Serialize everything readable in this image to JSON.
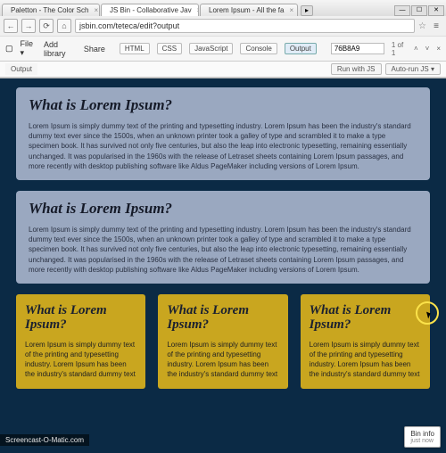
{
  "browser": {
    "tabs": [
      {
        "label": "Paletton - The Color Sch"
      },
      {
        "label": "JS Bin - Collaborative Jav"
      },
      {
        "label": "Lorem Ipsum - All the fa"
      }
    ],
    "nav": {
      "back": "←",
      "fwd": "→",
      "reload": "⟳",
      "home": "⌂"
    },
    "url": "jsbin.com/teteca/edit?output",
    "menu": "≡"
  },
  "toolbar": {
    "file": "File ▾",
    "addlib": "Add library",
    "share": "Share",
    "btns": {
      "html": "HTML",
      "css": "CSS",
      "js": "JavaScript",
      "console": "Console",
      "output": "Output"
    },
    "search_value": "76B8A9",
    "counter": "1 of 1",
    "prev": "˄",
    "next": "˅",
    "close": "×"
  },
  "subbar": {
    "label": "Output",
    "run": "Run with JS",
    "auto": "Auto-run JS",
    "chev": "▾"
  },
  "content": {
    "blocks": [
      {
        "h": "What is Lorem Ipsum?",
        "p": "Lorem Ipsum is simply dummy text of the printing and typesetting industry. Lorem Ipsum has been the industry's standard dummy text ever since the 1500s, when an unknown printer took a galley of type and scrambled it to make a type specimen book. It has survived not only five centuries, but also the leap into electronic typesetting, remaining essentially unchanged. It was popularised in the 1960s with the release of Letraset sheets containing Lorem Ipsum passages, and more recently with desktop publishing software like Aldus PageMaker including versions of Lorem Ipsum."
      },
      {
        "h": "What is Lorem Ipsum?",
        "p": "Lorem Ipsum is simply dummy text of the printing and typesetting industry. Lorem Ipsum has been the industry's standard dummy text ever since the 1500s, when an unknown printer took a galley of type and scrambled it to make a type specimen book. It has survived not only five centuries, but also the leap into electronic typesetting, remaining essentially unchanged. It was popularised in the 1960s with the release of Letraset sheets containing Lorem Ipsum passages, and more recently with desktop publishing software like Aldus PageMaker including versions of Lorem Ipsum."
      }
    ],
    "cards": [
      {
        "h": "What is Lorem Ipsum?",
        "p": "Lorem Ipsum is simply dummy text of the printing and typesetting industry. Lorem Ipsum has been the industry's standard dummy text"
      },
      {
        "h": "What is Lorem Ipsum?",
        "p": "Lorem Ipsum is simply dummy text of the printing and typesetting industry. Lorem Ipsum has been the industry's standard dummy text"
      },
      {
        "h": "What is Lorem Ipsum?",
        "p": "Lorem Ipsum is simply dummy text of the printing and typesetting industry. Lorem Ipsum has been the industry's standard dummy text"
      }
    ]
  },
  "bininfo": {
    "title": "Bin info",
    "sub": "just now"
  },
  "watermark": "Screencast-O-Matic.com"
}
